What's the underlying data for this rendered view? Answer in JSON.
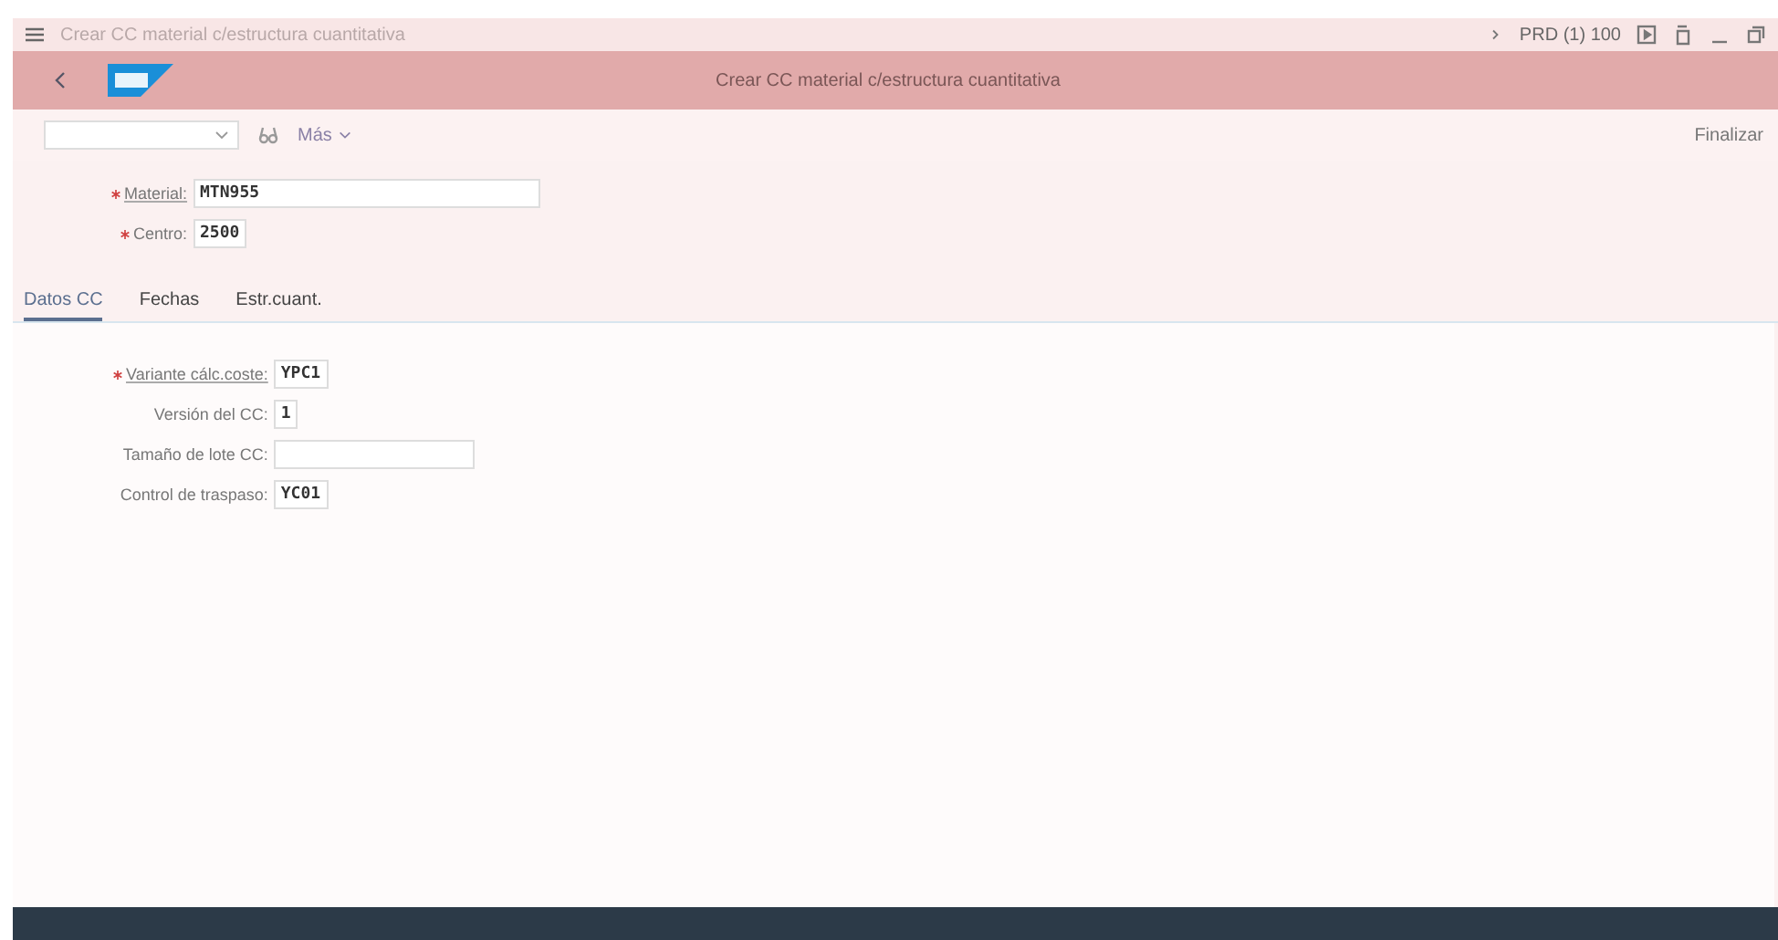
{
  "window": {
    "title": "Crear CC material c/estructura cuantitativa",
    "system": "PRD (1) 100"
  },
  "header": {
    "title": "Crear CC material c/estructura cuantitativa"
  },
  "toolbar": {
    "more": "Más",
    "exit": "Finalizar"
  },
  "header_fields": [
    {
      "label": "Material:",
      "value": "MTN955",
      "required": true,
      "linked": true,
      "kind": "long"
    },
    {
      "label": "Centro:",
      "value": "2500",
      "required": true,
      "linked": false,
      "kind": "short"
    }
  ],
  "tabs": [
    {
      "label": "Datos CC",
      "selected": true
    },
    {
      "label": "Fechas",
      "selected": false
    },
    {
      "label": "Estr.cuant.",
      "selected": false
    }
  ],
  "fields": [
    {
      "label": "Variante cálc.coste:",
      "value": "YPC1",
      "required": true,
      "linked": true,
      "kind": "short"
    },
    {
      "label": "Versión del CC:",
      "value": "1",
      "required": false,
      "linked": false,
      "kind": "short"
    },
    {
      "label": "Tamaño de lote CC:",
      "required": false,
      "linked": false,
      "kind": "medium"
    },
    {
      "label": "Control de traspaso:",
      "value": "YC01",
      "required": false,
      "linked": false,
      "kind": "short"
    }
  ]
}
